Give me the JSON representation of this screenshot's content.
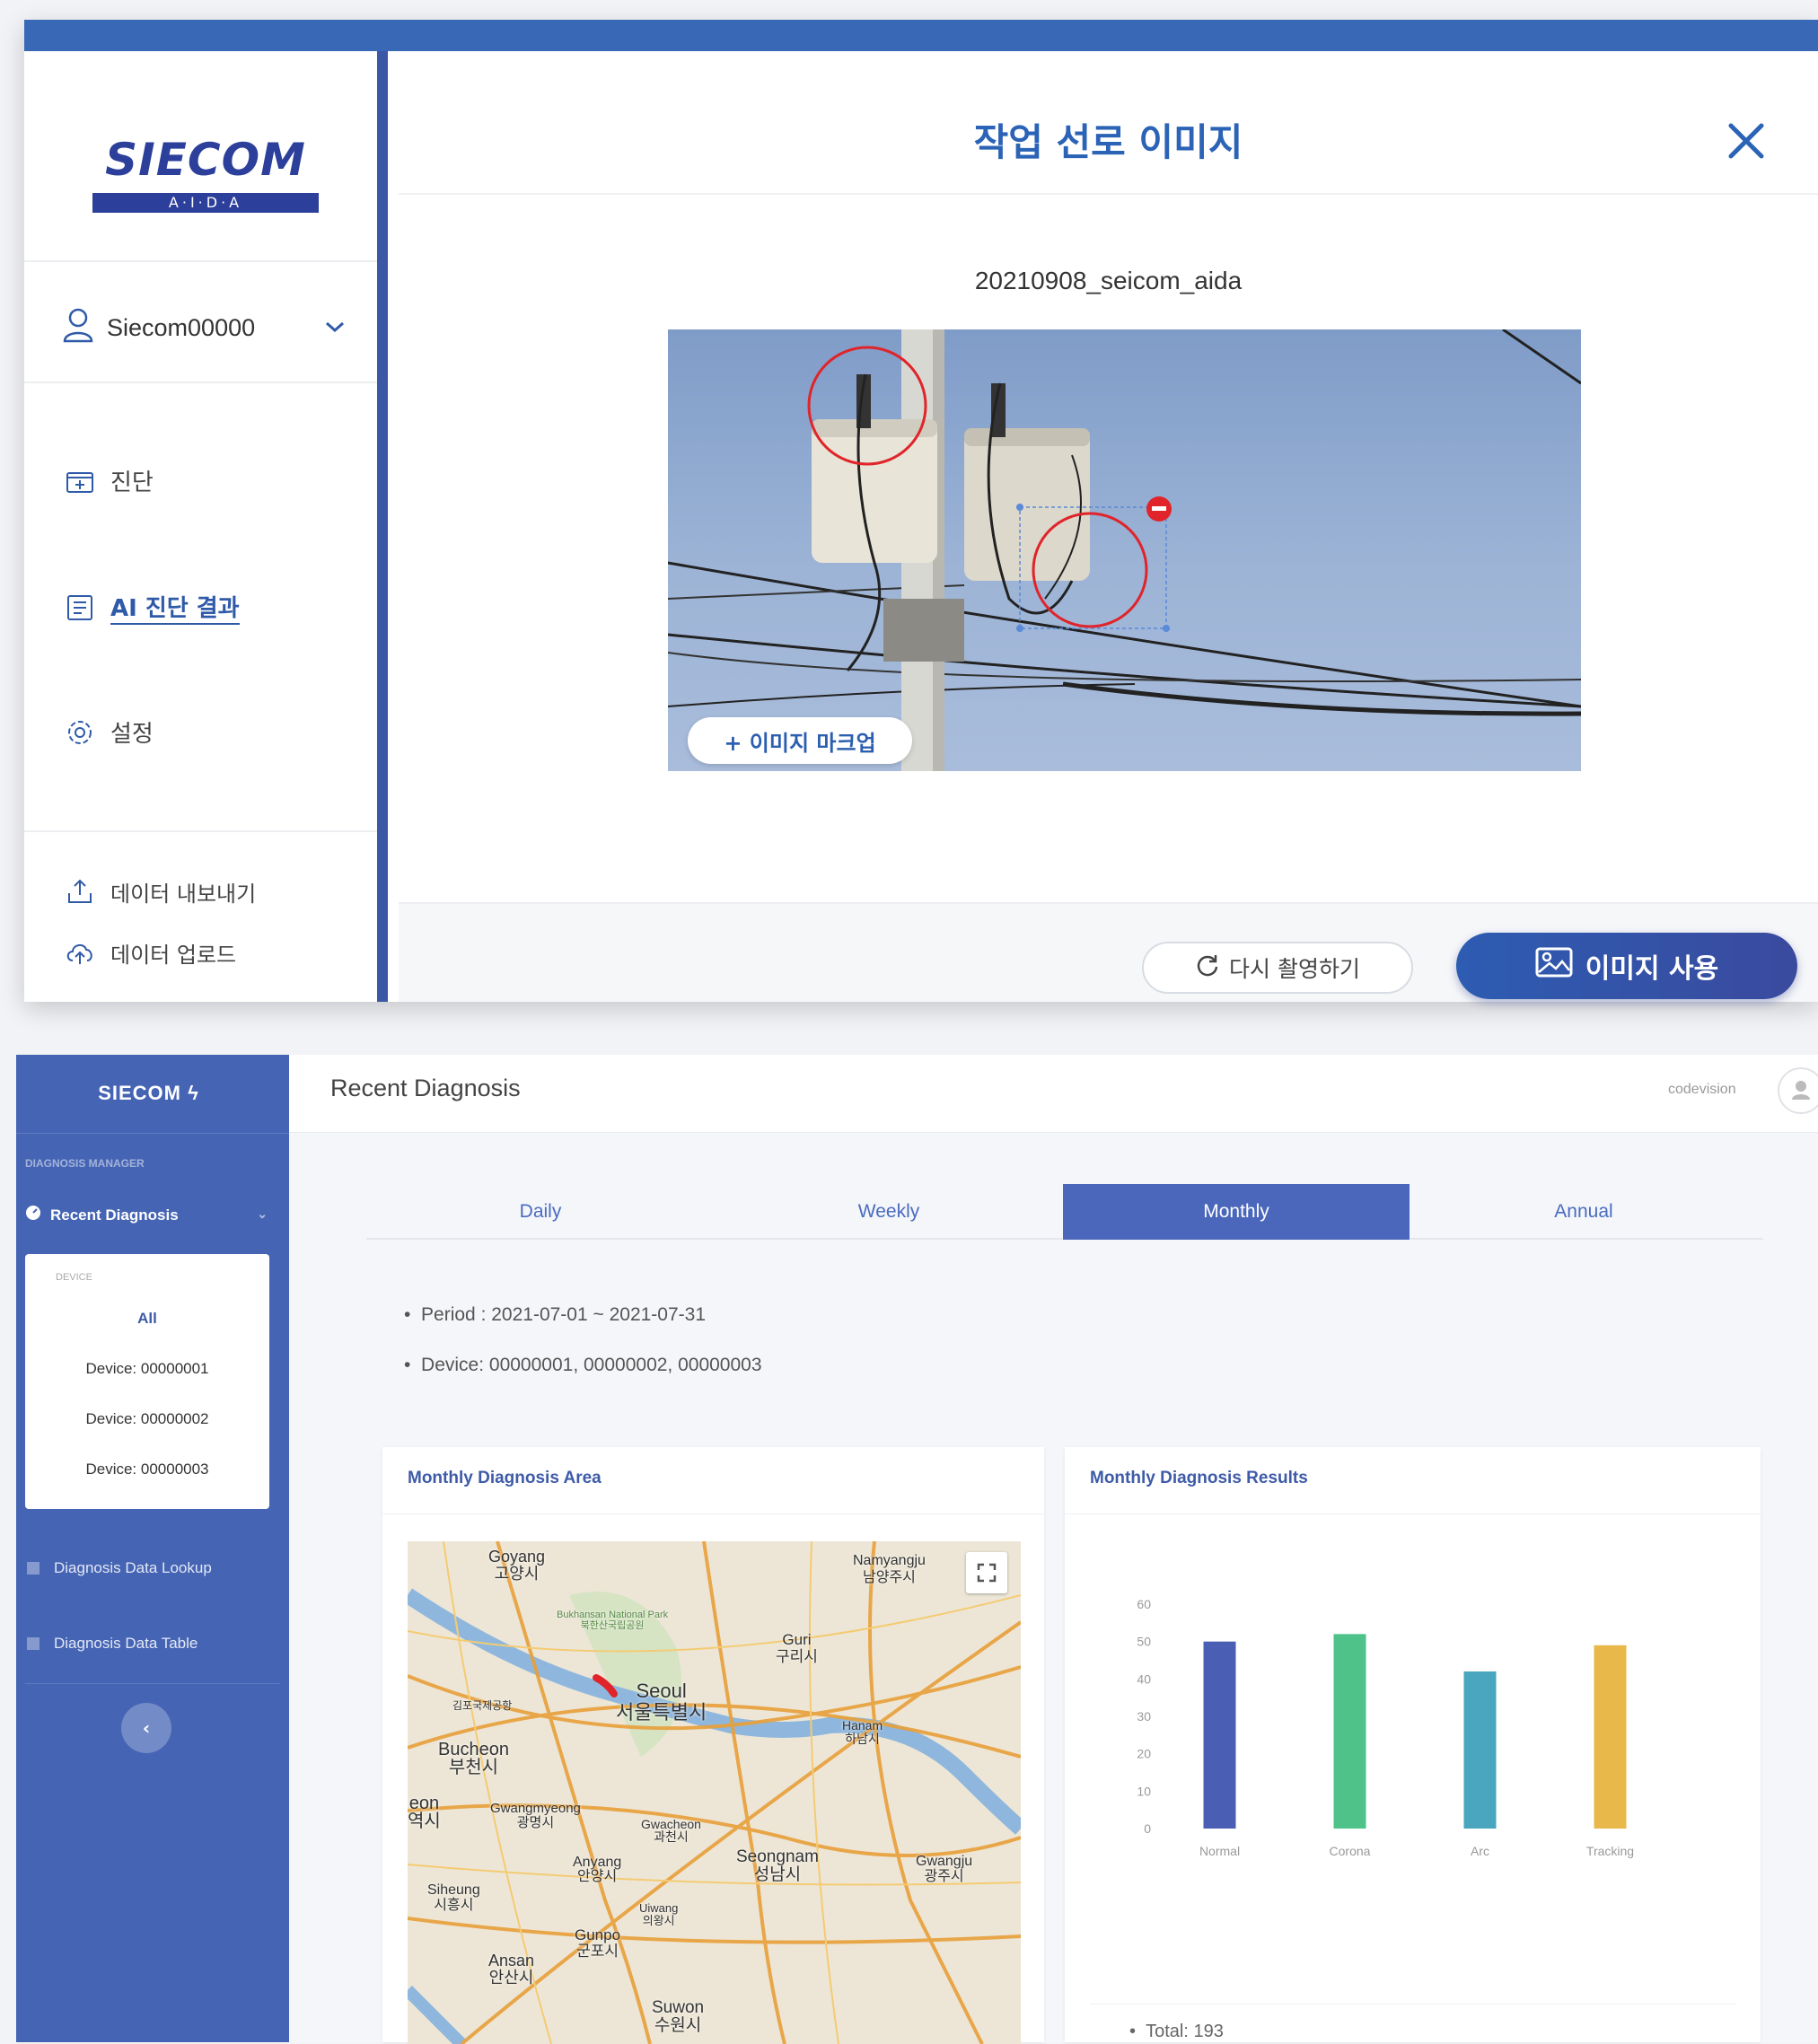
{
  "top": {
    "logo": {
      "brand": "SIECOM",
      "sub": "A·I·D·A"
    },
    "user": {
      "name": "Siecom00000"
    },
    "nav": [
      {
        "label": "진단",
        "icon": "diagnosis-icon"
      },
      {
        "label": "AI 진단 결과",
        "icon": "ai-result-icon"
      },
      {
        "label": "설정",
        "icon": "gear-icon"
      }
    ],
    "bottom_nav": [
      {
        "label": "데이터 내보내기",
        "icon": "export-icon"
      },
      {
        "label": "데이터 업로드",
        "icon": "cloud-upload-icon"
      }
    ],
    "modal": {
      "title": "작업 선로 이미지",
      "file_name": "20210908_seicom_aida",
      "markup_button": "+ 이미지 마크업",
      "retake_button": "다시 촬영하기",
      "use_button": "이미지 사용"
    },
    "colors": {
      "accent": "#2b63b6",
      "topbar": "#3969b6",
      "marker": "#e0242a"
    }
  },
  "bottom": {
    "brand": "SIECOM",
    "section_label": "DIAGNOSIS MANAGER",
    "recent_label": "Recent Diagnosis",
    "device_label": "DEVICE",
    "devices": [
      "All",
      "Device: 00000001",
      "Device: 00000002",
      "Device: 00000003"
    ],
    "nav": [
      "Diagnosis Data Lookup",
      "Diagnosis Data Table"
    ],
    "collapse_glyph": "‹",
    "header_title": "Recent Diagnosis",
    "user": "codevision",
    "tabs": [
      "Daily",
      "Weekly",
      "Monthly",
      "Annual"
    ],
    "active_tab": "Monthly",
    "period": "Period : 2021-07-01 ~ 2021-07-31",
    "device_line": "Device: 00000001, 00000002, 00000003",
    "map_card_title": "Monthly Diagnosis Area",
    "results_card_title": "Monthly Diagnosis Results",
    "total": "Total: 193",
    "map_labels": [
      {
        "text": "Goyang\n고양시"
      },
      {
        "text": "Namyangju\n남양주시"
      },
      {
        "text": "Bukhansan National Park\n북한산국립공원"
      },
      {
        "text": "Guri\n구리시"
      },
      {
        "text": "Seoul\n서울특별시"
      },
      {
        "text": "김포국제공항"
      },
      {
        "text": "Hanam\n하남시"
      },
      {
        "text": "Bucheon\n부천시"
      },
      {
        "text": "eon\n역시"
      },
      {
        "text": "Gwangmyeong\n광명시"
      },
      {
        "text": "Gwacheon\n과천시"
      },
      {
        "text": "Seongnam\n성남시"
      },
      {
        "text": "Gwangju\n광주시"
      },
      {
        "text": "Anyang\n안양시"
      },
      {
        "text": "Siheung\n시흥시"
      },
      {
        "text": "Uiwang\n의왕시"
      },
      {
        "text": "Gunpo\n군포시"
      },
      {
        "text": "Ansan\n안산시"
      },
      {
        "text": "Suwon\n수원시"
      }
    ],
    "chart_data": {
      "type": "bar",
      "categories": [
        "Normal",
        "Corona",
        "Arc",
        "Tracking"
      ],
      "values": [
        50,
        52,
        42,
        49
      ],
      "ylim": [
        0,
        60
      ],
      "yticks": [
        0,
        10,
        20,
        30,
        40,
        50,
        60
      ],
      "colors": [
        "#4a5fb3",
        "#4fc28a",
        "#4aa6bf",
        "#e8b84a"
      ],
      "grid": false
    }
  }
}
